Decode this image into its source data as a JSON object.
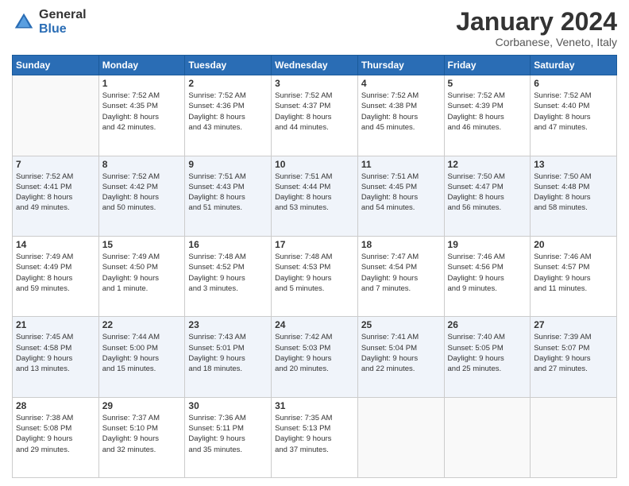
{
  "header": {
    "logo_general": "General",
    "logo_blue": "Blue",
    "month_title": "January 2024",
    "subtitle": "Corbanese, Veneto, Italy"
  },
  "weekdays": [
    "Sunday",
    "Monday",
    "Tuesday",
    "Wednesday",
    "Thursday",
    "Friday",
    "Saturday"
  ],
  "weeks": [
    [
      {
        "day": "",
        "info": ""
      },
      {
        "day": "1",
        "info": "Sunrise: 7:52 AM\nSunset: 4:35 PM\nDaylight: 8 hours\nand 42 minutes."
      },
      {
        "day": "2",
        "info": "Sunrise: 7:52 AM\nSunset: 4:36 PM\nDaylight: 8 hours\nand 43 minutes."
      },
      {
        "day": "3",
        "info": "Sunrise: 7:52 AM\nSunset: 4:37 PM\nDaylight: 8 hours\nand 44 minutes."
      },
      {
        "day": "4",
        "info": "Sunrise: 7:52 AM\nSunset: 4:38 PM\nDaylight: 8 hours\nand 45 minutes."
      },
      {
        "day": "5",
        "info": "Sunrise: 7:52 AM\nSunset: 4:39 PM\nDaylight: 8 hours\nand 46 minutes."
      },
      {
        "day": "6",
        "info": "Sunrise: 7:52 AM\nSunset: 4:40 PM\nDaylight: 8 hours\nand 47 minutes."
      }
    ],
    [
      {
        "day": "7",
        "info": "Sunrise: 7:52 AM\nSunset: 4:41 PM\nDaylight: 8 hours\nand 49 minutes."
      },
      {
        "day": "8",
        "info": "Sunrise: 7:52 AM\nSunset: 4:42 PM\nDaylight: 8 hours\nand 50 minutes."
      },
      {
        "day": "9",
        "info": "Sunrise: 7:51 AM\nSunset: 4:43 PM\nDaylight: 8 hours\nand 51 minutes."
      },
      {
        "day": "10",
        "info": "Sunrise: 7:51 AM\nSunset: 4:44 PM\nDaylight: 8 hours\nand 53 minutes."
      },
      {
        "day": "11",
        "info": "Sunrise: 7:51 AM\nSunset: 4:45 PM\nDaylight: 8 hours\nand 54 minutes."
      },
      {
        "day": "12",
        "info": "Sunrise: 7:50 AM\nSunset: 4:47 PM\nDaylight: 8 hours\nand 56 minutes."
      },
      {
        "day": "13",
        "info": "Sunrise: 7:50 AM\nSunset: 4:48 PM\nDaylight: 8 hours\nand 58 minutes."
      }
    ],
    [
      {
        "day": "14",
        "info": "Sunrise: 7:49 AM\nSunset: 4:49 PM\nDaylight: 8 hours\nand 59 minutes."
      },
      {
        "day": "15",
        "info": "Sunrise: 7:49 AM\nSunset: 4:50 PM\nDaylight: 9 hours\nand 1 minute."
      },
      {
        "day": "16",
        "info": "Sunrise: 7:48 AM\nSunset: 4:52 PM\nDaylight: 9 hours\nand 3 minutes."
      },
      {
        "day": "17",
        "info": "Sunrise: 7:48 AM\nSunset: 4:53 PM\nDaylight: 9 hours\nand 5 minutes."
      },
      {
        "day": "18",
        "info": "Sunrise: 7:47 AM\nSunset: 4:54 PM\nDaylight: 9 hours\nand 7 minutes."
      },
      {
        "day": "19",
        "info": "Sunrise: 7:46 AM\nSunset: 4:56 PM\nDaylight: 9 hours\nand 9 minutes."
      },
      {
        "day": "20",
        "info": "Sunrise: 7:46 AM\nSunset: 4:57 PM\nDaylight: 9 hours\nand 11 minutes."
      }
    ],
    [
      {
        "day": "21",
        "info": "Sunrise: 7:45 AM\nSunset: 4:58 PM\nDaylight: 9 hours\nand 13 minutes."
      },
      {
        "day": "22",
        "info": "Sunrise: 7:44 AM\nSunset: 5:00 PM\nDaylight: 9 hours\nand 15 minutes."
      },
      {
        "day": "23",
        "info": "Sunrise: 7:43 AM\nSunset: 5:01 PM\nDaylight: 9 hours\nand 18 minutes."
      },
      {
        "day": "24",
        "info": "Sunrise: 7:42 AM\nSunset: 5:03 PM\nDaylight: 9 hours\nand 20 minutes."
      },
      {
        "day": "25",
        "info": "Sunrise: 7:41 AM\nSunset: 5:04 PM\nDaylight: 9 hours\nand 22 minutes."
      },
      {
        "day": "26",
        "info": "Sunrise: 7:40 AM\nSunset: 5:05 PM\nDaylight: 9 hours\nand 25 minutes."
      },
      {
        "day": "27",
        "info": "Sunrise: 7:39 AM\nSunset: 5:07 PM\nDaylight: 9 hours\nand 27 minutes."
      }
    ],
    [
      {
        "day": "28",
        "info": "Sunrise: 7:38 AM\nSunset: 5:08 PM\nDaylight: 9 hours\nand 29 minutes."
      },
      {
        "day": "29",
        "info": "Sunrise: 7:37 AM\nSunset: 5:10 PM\nDaylight: 9 hours\nand 32 minutes."
      },
      {
        "day": "30",
        "info": "Sunrise: 7:36 AM\nSunset: 5:11 PM\nDaylight: 9 hours\nand 35 minutes."
      },
      {
        "day": "31",
        "info": "Sunrise: 7:35 AM\nSunset: 5:13 PM\nDaylight: 9 hours\nand 37 minutes."
      },
      {
        "day": "",
        "info": ""
      },
      {
        "day": "",
        "info": ""
      },
      {
        "day": "",
        "info": ""
      }
    ]
  ]
}
